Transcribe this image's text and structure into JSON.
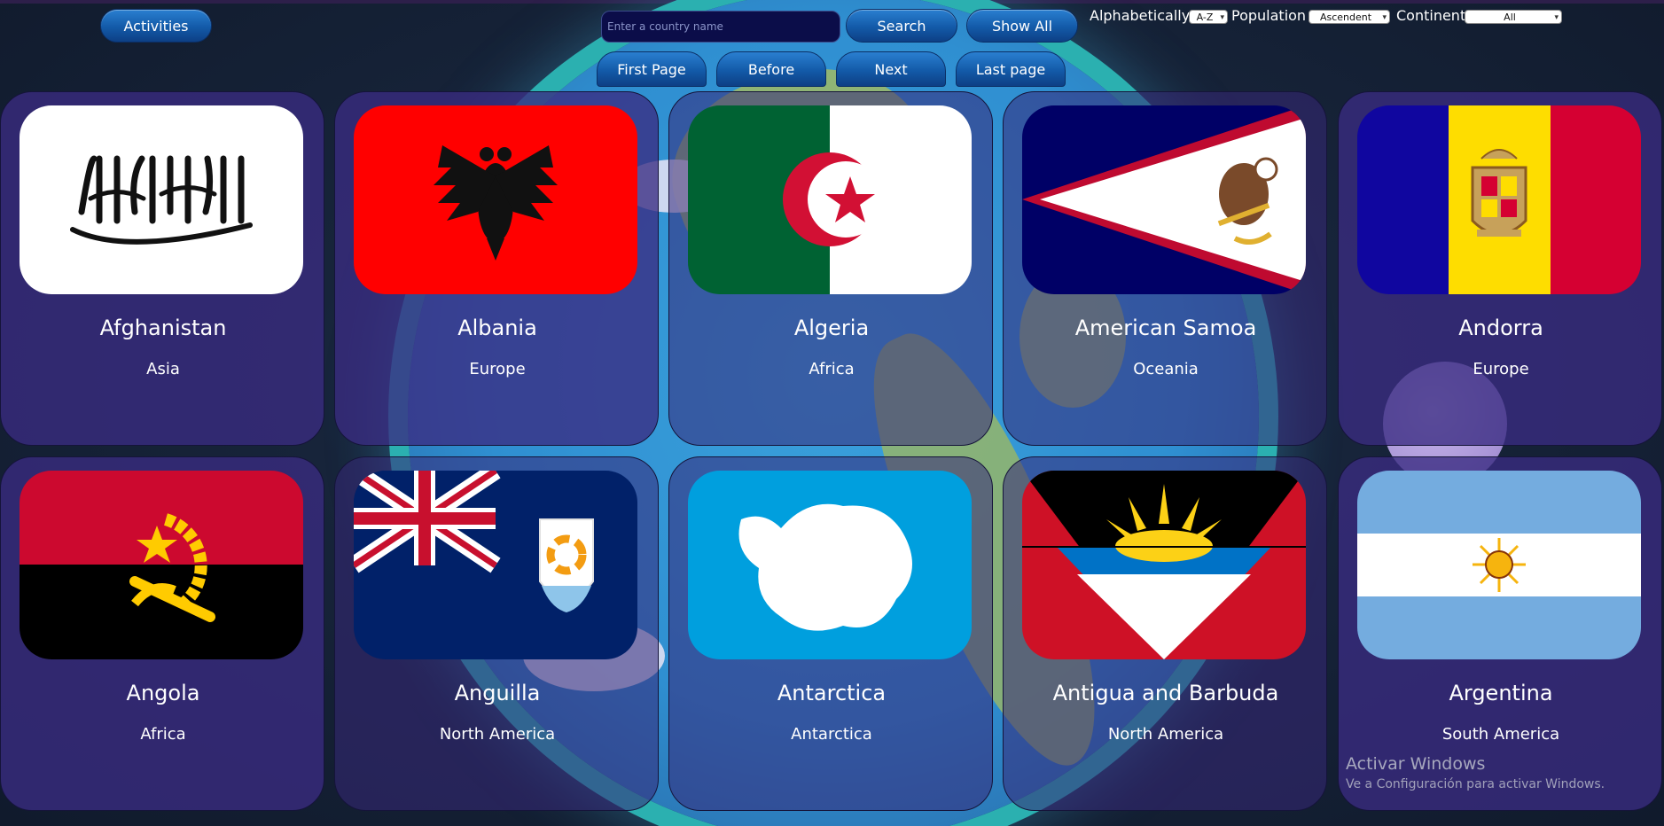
{
  "header": {
    "activities_label": "Activities",
    "search_placeholder": "Enter a country name",
    "search_label": "Search",
    "show_all_label": "Show All",
    "alphabetically_label": "Alphabetically",
    "alphabetically_value": "A-Z",
    "population_label": "Population",
    "population_value": "Ascendent",
    "continent_label": "Continent",
    "continent_value": "All"
  },
  "pagination": {
    "first_label": "First Page",
    "before_label": "Before",
    "next_label": "Next",
    "last_label": "Last page"
  },
  "countries": [
    {
      "name": "Afghanistan",
      "continent": "Asia",
      "flag_icon": "afghanistan-flag-icon"
    },
    {
      "name": "Albania",
      "continent": "Europe",
      "flag_icon": "albania-flag-icon"
    },
    {
      "name": "Algeria",
      "continent": "Africa",
      "flag_icon": "algeria-flag-icon"
    },
    {
      "name": "American Samoa",
      "continent": "Oceania",
      "flag_icon": "american-samoa-flag-icon"
    },
    {
      "name": "Andorra",
      "continent": "Europe",
      "flag_icon": "andorra-flag-icon"
    },
    {
      "name": "Angola",
      "continent": "Africa",
      "flag_icon": "angola-flag-icon"
    },
    {
      "name": "Anguilla",
      "continent": "North America",
      "flag_icon": "anguilla-flag-icon"
    },
    {
      "name": "Antarctica",
      "continent": "Antarctica",
      "flag_icon": "antarctica-flag-icon"
    },
    {
      "name": "Antigua and Barbuda",
      "continent": "North America",
      "flag_icon": "antigua-and-barbuda-flag-icon"
    },
    {
      "name": "Argentina",
      "continent": "South America",
      "flag_icon": "argentina-flag-icon"
    }
  ],
  "watermark": {
    "line1": "Activar Windows",
    "line2": "Ve a Configuración para activar Windows."
  },
  "colors": {
    "card_bg": "#3a2c82",
    "button_blue": "#135aa8",
    "search_bg": "#0b0d49"
  }
}
